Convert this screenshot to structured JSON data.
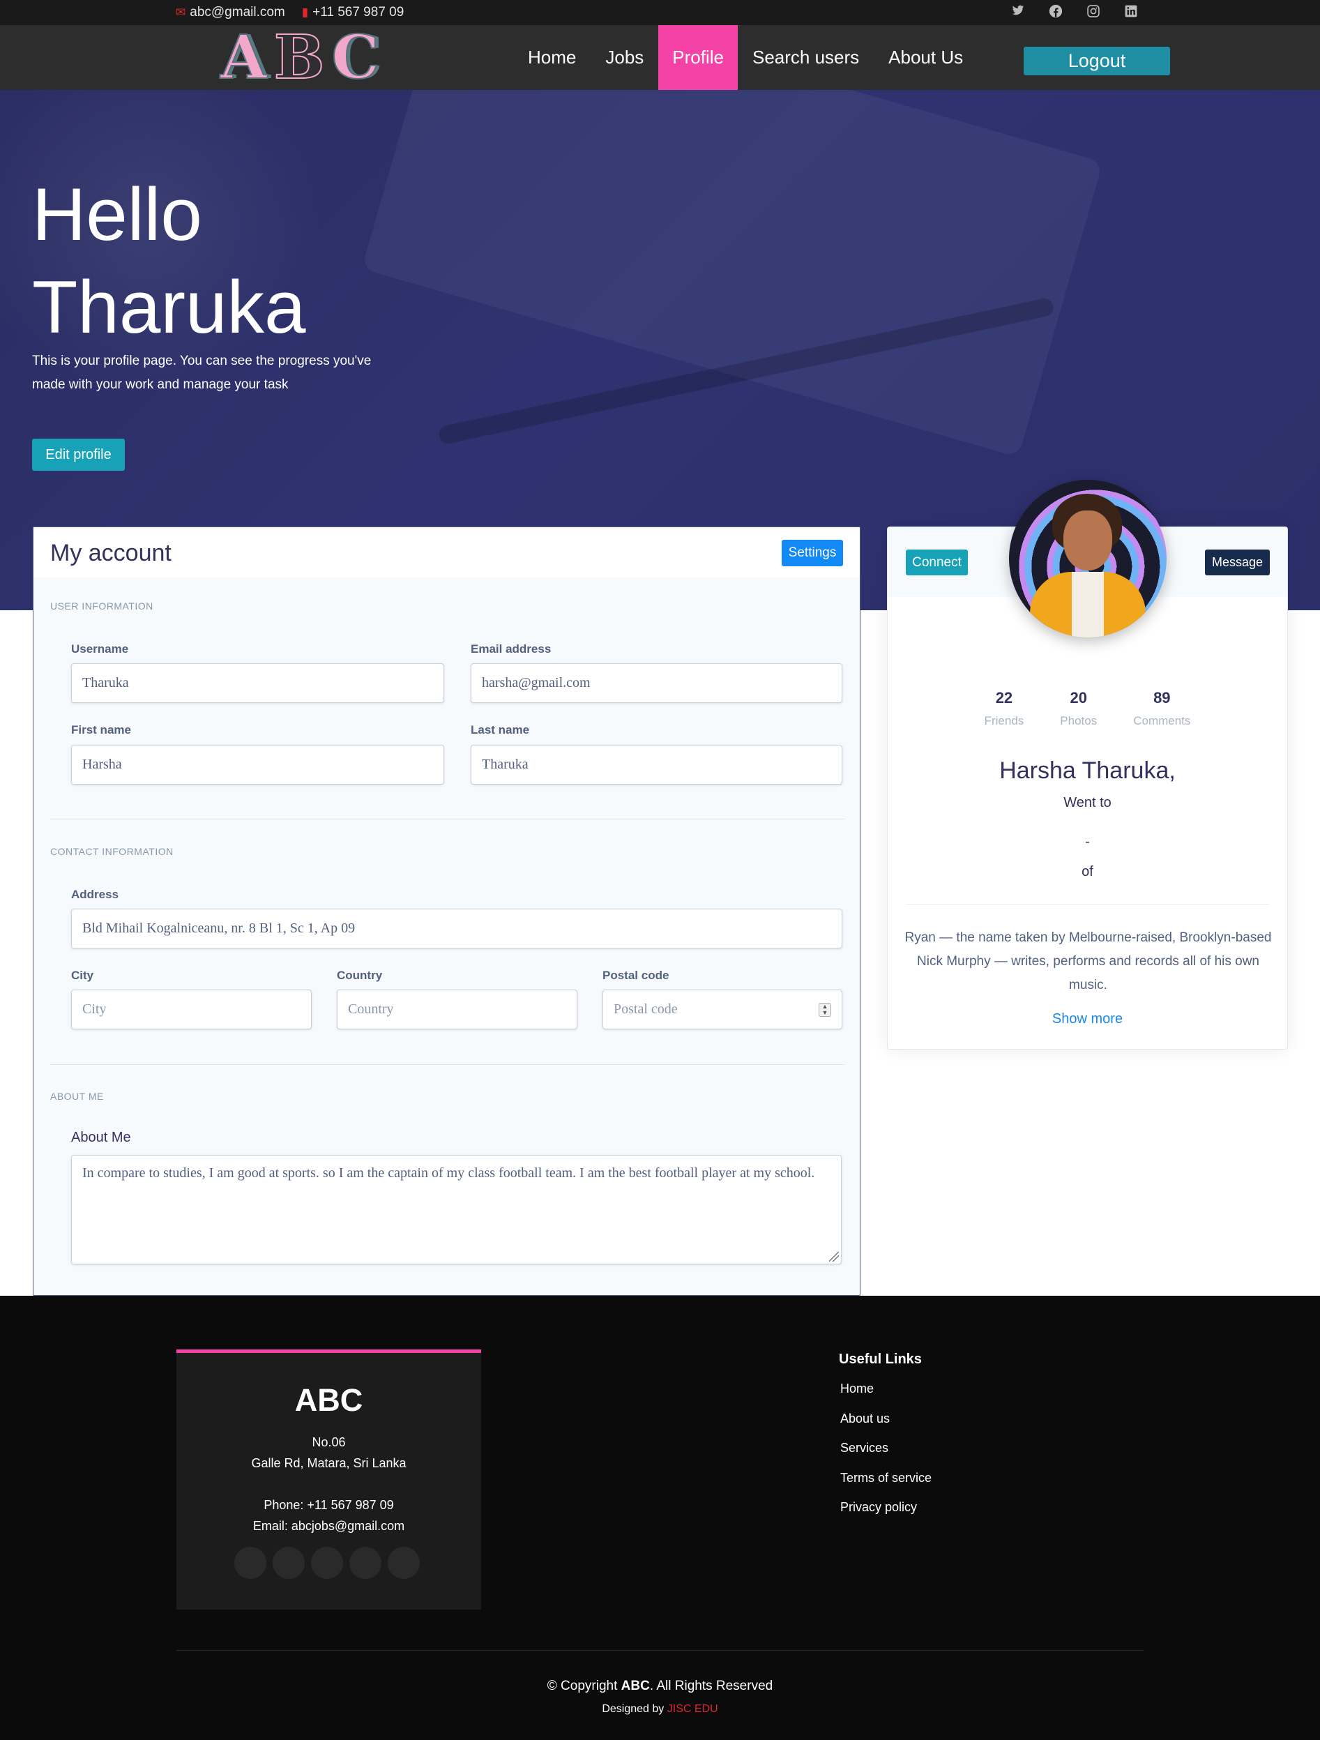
{
  "topbar": {
    "email": "abc@gmail.com",
    "phone": "+11 567 987 09",
    "social": [
      "twitter-icon",
      "facebook-icon",
      "instagram-icon",
      "linkedin-icon"
    ]
  },
  "nav": {
    "logo": [
      "A",
      "B",
      "C"
    ],
    "items": [
      {
        "label": "Home"
      },
      {
        "label": "Jobs"
      },
      {
        "label": "Profile",
        "active": true
      },
      {
        "label": "Search users"
      },
      {
        "label": "About Us"
      }
    ],
    "logout": "Logout"
  },
  "hero": {
    "greeting": "Hello",
    "name": "Tharuka",
    "description": "This is your profile page. You can see the progress you've made with your work and manage your task",
    "edit_button": "Edit profile"
  },
  "account": {
    "title": "My account",
    "settings": "Settings",
    "user_info": {
      "section": "User information",
      "username_label": "Username",
      "username": "Tharuka",
      "email_label": "Email address",
      "email": "harsha@gmail.com",
      "first_name_label": "First name",
      "first_name": "Harsha",
      "last_name_label": "Last name",
      "last_name": "Tharuka"
    },
    "contact": {
      "section": "Contact information",
      "address_label": "Address",
      "address": "Bld Mihail Kogalniceanu, nr. 8 Bl 1, Sc 1, Ap 09",
      "city_label": "City",
      "city_placeholder": "City",
      "country_label": "Country",
      "country_placeholder": "Country",
      "postal_label": "Postal code",
      "postal_placeholder": "Postal code"
    },
    "about": {
      "section": "About me",
      "label": "About Me",
      "text": "In compare to studies, I am good at sports. so I am the captain of my class football team. I am the best football player at my school."
    }
  },
  "profile_card": {
    "connect": "Connect",
    "message": "Message",
    "stats": [
      {
        "value": "22",
        "label": "Friends"
      },
      {
        "value": "20",
        "label": "Photos"
      },
      {
        "value": "89",
        "label": "Comments"
      }
    ],
    "name": "Harsha Tharuka,",
    "went_to": "Went to",
    "dash": "-",
    "of": "of",
    "bio": "Ryan — the name taken by Melbourne-raised, Brooklyn-based Nick Murphy — writes, performs and records all of his own music.",
    "show_more": "Show more"
  },
  "footer": {
    "brand": "ABC",
    "address1": "No.06",
    "address2": "Galle Rd, Matara, Sri Lanka",
    "phone": "Phone: +11 567 987 09",
    "email": "Email: abcjobs@gmail.com",
    "links_title": "Useful Links",
    "links": [
      "Home",
      "About us",
      "Services",
      "Terms of service",
      "Privacy policy"
    ],
    "copyright_prefix": "© Copyright",
    "copyright_brand": "ABC",
    "copyright_suffix": ". All Rights Reserved",
    "designed_prefix": "Designed by",
    "designed_by": "JISC EDU"
  },
  "colors": {
    "accent_pink": "#f542a7",
    "teal": "#17a2b8",
    "blue": "#1289f5",
    "hero_bg": "#2c2f6a"
  }
}
